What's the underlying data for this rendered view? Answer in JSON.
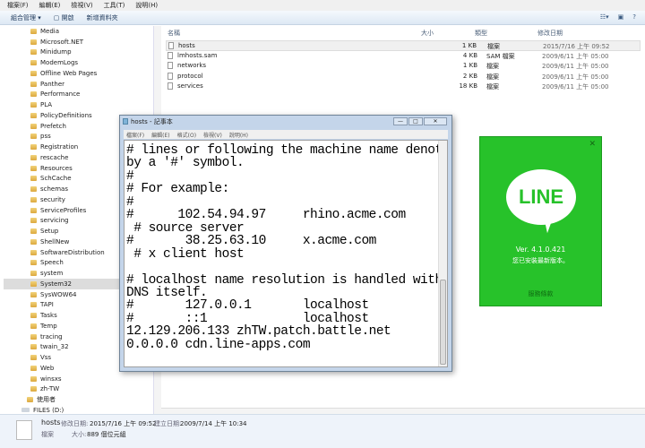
{
  "menu": [
    "檔案(F)",
    "編輯(E)",
    "檢視(V)",
    "工具(T)",
    "說明(H)"
  ],
  "toolbar": {
    "organize": "組合管理 ▾",
    "open": "開啟",
    "new_folder": "新增資料夾"
  },
  "sidebar": [
    "Media",
    "Microsoft.NET",
    "Minidump",
    "ModemLogs",
    "Offline Web Pages",
    "Panther",
    "Performance",
    "PLA",
    "PolicyDefinitions",
    "Prefetch",
    "pss",
    "Registration",
    "rescache",
    "Resources",
    "SchCache",
    "schemas",
    "security",
    "ServiceProfiles",
    "servicing",
    "Setup",
    "ShellNew",
    "SoftwareDistribution",
    "Speech",
    "system",
    "System32",
    "SysWOW64",
    "TAPI",
    "Tasks",
    "Temp",
    "tracing",
    "twain_32",
    "Vss",
    "Web",
    "winsxs",
    "zh-TW",
    "使用者",
    "FILES (D:)"
  ],
  "columns": {
    "name": "名稱",
    "size": "大小",
    "type": "類型",
    "modified": "修改日期"
  },
  "files": [
    {
      "name": "hosts",
      "size": "1 KB",
      "type": "檔案",
      "modified": "2015/7/16 上午 09:52"
    },
    {
      "name": "lmhosts.sam",
      "size": "4 KB",
      "type": "SAM 檔案",
      "modified": "2009/6/11 上午 05:00"
    },
    {
      "name": "networks",
      "size": "1 KB",
      "type": "檔案",
      "modified": "2009/6/11 上午 05:00"
    },
    {
      "name": "protocol",
      "size": "2 KB",
      "type": "檔案",
      "modified": "2009/6/11 上午 05:00"
    },
    {
      "name": "services",
      "size": "18 KB",
      "type": "檔案",
      "modified": "2009/6/11 上午 05:00"
    }
  ],
  "details": {
    "name": "hosts",
    "modified_label": "修改日期:",
    "modified": "2015/7/16 上午 09:52",
    "created_label": "建立日期:",
    "created": "2009/7/14 上午 10:34",
    "type": "檔案",
    "size_label": "大小:",
    "size": "889 個位元組"
  },
  "notepad": {
    "title": "hosts - 記事本",
    "menu": [
      "檔案(F)",
      "編輯(E)",
      "格式(O)",
      "檢視(V)",
      "說明(H)"
    ],
    "text": "# lines or following the machine name denoted\nby a '#' symbol.\n#\n# For example:\n#\n#      102.54.94.97     rhino.acme.com\n # source server\n#       38.25.63.10     x.acme.com\n # x client host\n\n# localhost name resolution is handled within\nDNS itself.\n#       127.0.0.1       localhost\n#       ::1             localhost\n12.129.206.133 zhTW.patch.battle.net\n0.0.0.0 cdn.line-apps.com"
  },
  "line": {
    "logo": "LINE",
    "version": "Ver. 4.1.0.421",
    "status": "您已安裝最新版本。",
    "terms": "服務條款",
    "accent": "#27c22a"
  }
}
